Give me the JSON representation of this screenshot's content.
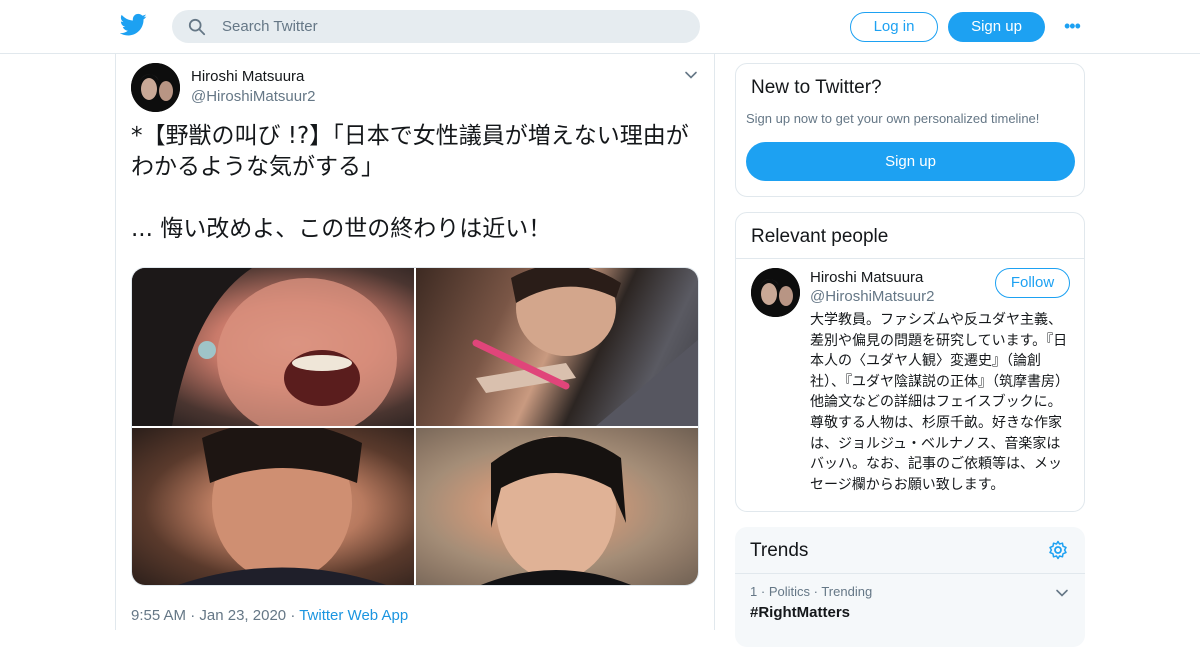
{
  "header": {
    "search_placeholder": "Search Twitter",
    "login_label": "Log in",
    "signup_label": "Sign up",
    "more_label": "•••"
  },
  "tweet": {
    "author_name": "Hiroshi Matsuura",
    "author_handle": "@HiroshiMatsuur2",
    "text": "*【野獣の叫び !?】「日本で女性議員が増えない理由がわかるような気がする」\n\n... 悔い改めよ、この世の終わりは近い！",
    "time": "9:55 AM",
    "date": "Jan 23, 2020",
    "source": "Twitter Web App",
    "media_count": 4
  },
  "new_to_twitter": {
    "title": "New to Twitter?",
    "subtitle": "Sign up now to get your own personalized timeline!",
    "button": "Sign up"
  },
  "relevant_people": {
    "title": "Relevant people",
    "person": {
      "name": "Hiroshi Matsuura",
      "handle": "@HiroshiMatsuur2",
      "follow_label": "Follow",
      "bio": "大学教員。ファシズムや反ユダヤ主義、差別や偏見の問題を研究しています。『日本人の〈ユダヤ人観〉変遷史』（論創社）、『ユダヤ陰謀説の正体』（筑摩書房）他論文などの詳細はフェイスブックに。尊敬する人物は、杉原千畝。好きな作家は、ジョルジュ・ベルナノス、音楽家はバッハ。なお、記事のご依頼等は、メッセージ欄からお願い致します。"
    }
  },
  "trends": {
    "title": "Trends",
    "items": [
      {
        "rank": "1",
        "category": "Politics",
        "status": "Trending",
        "name": "#RightMatters"
      }
    ]
  },
  "colors": {
    "accent": "#1da1f2",
    "text": "#14171a",
    "muted": "#657786",
    "border": "#e1e8ed"
  }
}
